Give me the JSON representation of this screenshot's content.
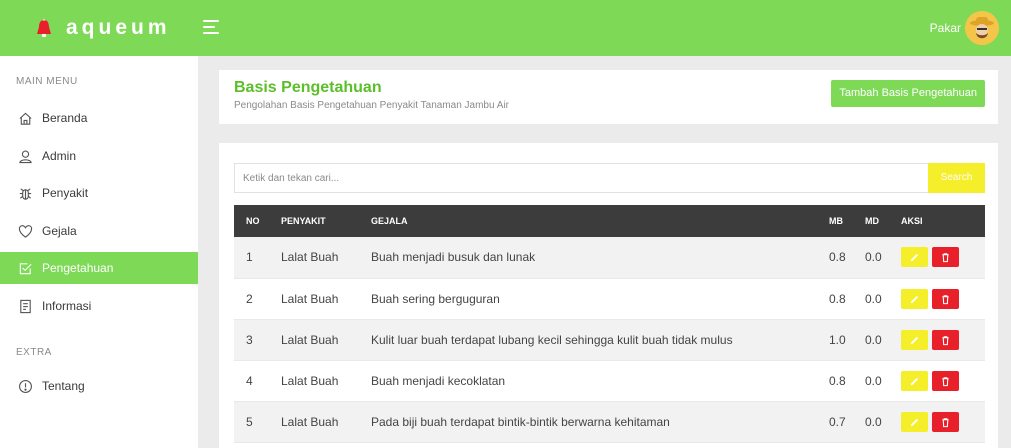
{
  "app": {
    "brand": "aqueum",
    "user_name": "Pakar"
  },
  "sidebar": {
    "main_menu_label": "MAIN MENU",
    "extra_label": "EXTRA",
    "items": [
      {
        "label": "Beranda",
        "icon": "home-icon"
      },
      {
        "label": "Admin",
        "icon": "user-icon"
      },
      {
        "label": "Penyakit",
        "icon": "bug-icon"
      },
      {
        "label": "Gejala",
        "icon": "shield-heart-icon"
      },
      {
        "label": "Pengetahuan",
        "icon": "checkbox-icon",
        "active": true
      },
      {
        "label": "Informasi",
        "icon": "document-icon"
      }
    ],
    "extra_items": [
      {
        "label": "Tentang",
        "icon": "info-icon"
      }
    ]
  },
  "header": {
    "title": "Basis Pengetahuan",
    "subtitle": "Pengolahan Basis Pengetahuan Penyakit Tanaman Jambu Air",
    "add_button": "Tambah Basis Pengetahuan"
  },
  "search": {
    "placeholder": "Ketik dan tekan cari...",
    "button": "Search"
  },
  "table": {
    "columns": [
      "NO",
      "PENYAKIT",
      "GEJALA",
      "MB",
      "MD",
      "AKSI"
    ],
    "rows": [
      [
        "1",
        "Lalat Buah",
        "Buah menjadi busuk dan lunak",
        "0.8",
        "0.0"
      ],
      [
        "2",
        "Lalat Buah",
        "Buah sering berguguran",
        "0.8",
        "0.0"
      ],
      [
        "3",
        "Lalat Buah",
        "Kulit luar buah terdapat lubang kecil sehingga kulit buah tidak mulus",
        "1.0",
        "0.0"
      ],
      [
        "4",
        "Lalat Buah",
        "Buah menjadi kecoklatan",
        "0.8",
        "0.0"
      ],
      [
        "5",
        "Lalat Buah",
        "Pada biji buah terdapat bintik-bintik berwarna kehitaman",
        "0.7",
        "0.0"
      ]
    ]
  },
  "colors": {
    "primary": "#7ed957",
    "title": "#5cbf2a",
    "edit": "#f5ee2a",
    "delete": "#e8202a",
    "table_head": "#3c3c3c"
  }
}
